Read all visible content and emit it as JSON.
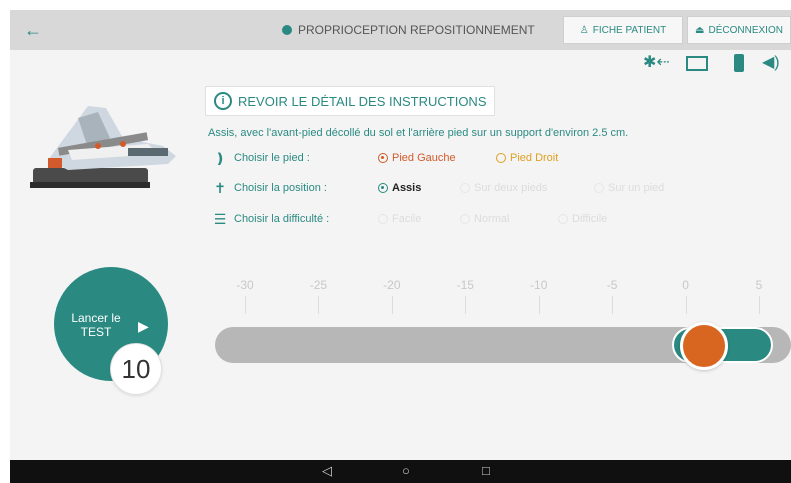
{
  "topbar": {
    "back_icon": "back-arrow-icon",
    "title": "PROPRIOCEPTION REPOSITIONNEMENT",
    "fiche_label": "FICHE PATIENT",
    "deconnexion_label": "DÉCONNEXION",
    "background": "#d8d8d8"
  },
  "status_icons": [
    "bluetooth-icon",
    "device-icon",
    "battery-icon",
    "volume-icon"
  ],
  "review_button": {
    "label": "REVOIR LE DÉTAIL DES INSTRUCTIONS"
  },
  "instruction": "Assis, avec l'avant-pied décollé du sol et l'arrière pied sur un support d'environ 2.5 cm.",
  "foot_choice": {
    "label": "Choisir le pied :",
    "options": [
      "Pied Gauche",
      "Pied Droit"
    ],
    "selected": "Pied Gauche"
  },
  "position_choice": {
    "label": "Choisir la position :",
    "options": [
      "Assis",
      "Sur deux pieds",
      "Sur un pied"
    ],
    "selected": "Assis"
  },
  "difficulty_choice": {
    "label": "Choisir la difficulté :",
    "options": [
      "Facile",
      "Normal",
      "Difficile"
    ],
    "selected": null
  },
  "launch": {
    "label_line1": "Lancer le",
    "label_line2": "TEST",
    "count": "10"
  },
  "scale": {
    "ticks": [
      "-30",
      "-25",
      "-20",
      "-15",
      "-10",
      "-5",
      "0",
      "5"
    ],
    "value": 1.5
  },
  "colors": {
    "accent": "#2a8a82",
    "thumb": "#d96620",
    "track": "#b7b7b7",
    "left_foot": "#d35a2a",
    "right_foot": "#e0a020"
  },
  "nav": [
    "nav-back-icon",
    "nav-home-icon",
    "nav-recent-icon"
  ]
}
